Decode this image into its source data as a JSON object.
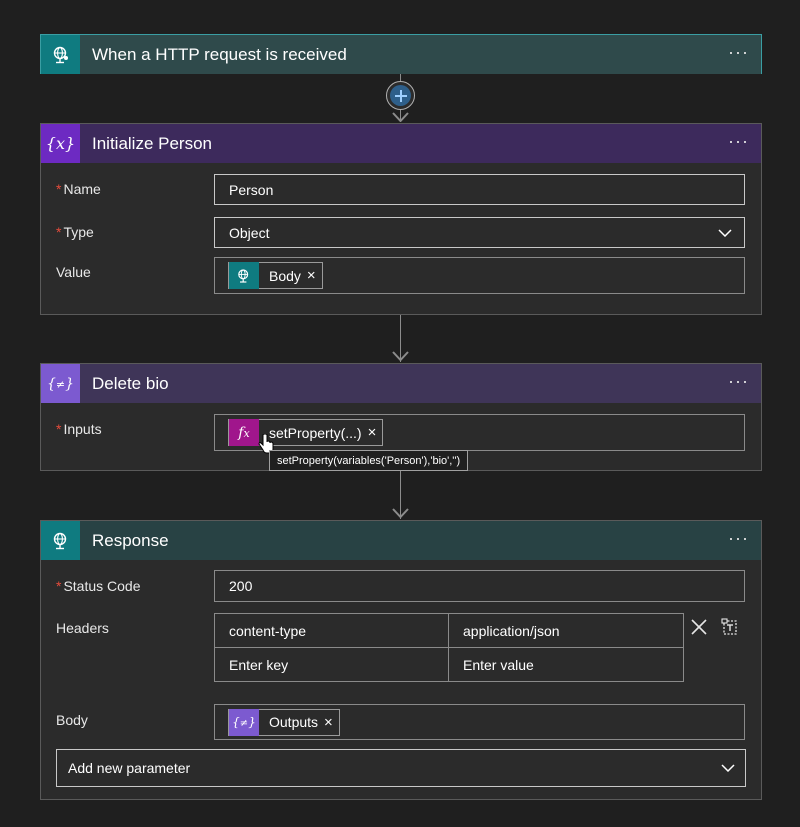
{
  "colors": {
    "http_teal": "#0f7b80",
    "variable_purple": "#6d2ac2",
    "delete_purple": "#7c5ad0",
    "response_teal": "#0f7b80",
    "expression_magenta": "#a0168c",
    "required_red": "#e74c3c",
    "add_button_blue": "#4aa2e8"
  },
  "trigger": {
    "icon": "globe-icon",
    "title": "When a HTTP request is received",
    "more": "···"
  },
  "init_person": {
    "icon": "variable-icon",
    "icon_glyph": "{x}",
    "title": "Initialize Person",
    "more": "···",
    "fields": {
      "name_label": "Name",
      "name_value": "Person",
      "type_label": "Type",
      "type_value": "Object",
      "value_label": "Value",
      "value_token": "Body",
      "token_close": "×"
    }
  },
  "delete_bio": {
    "icon": "variable-set-icon",
    "title": "Delete bio",
    "more": "···",
    "fields": {
      "inputs_label": "Inputs",
      "inputs_token": "setProperty(...)",
      "token_close": "×",
      "tooltip": "setProperty(variables('Person'),'bio','')"
    }
  },
  "response": {
    "icon": "globe-icon",
    "title": "Response",
    "more": "···",
    "fields": {
      "status_label": "Status Code",
      "status_value": "200",
      "headers_label": "Headers",
      "headers": [
        {
          "key": "content-type",
          "value": "application/json"
        },
        {
          "key": "Enter key",
          "value": "Enter value"
        }
      ],
      "body_label": "Body",
      "body_token": "Outputs",
      "token_close": "×",
      "add_param": "Add new parameter"
    }
  },
  "required_mark": "*"
}
